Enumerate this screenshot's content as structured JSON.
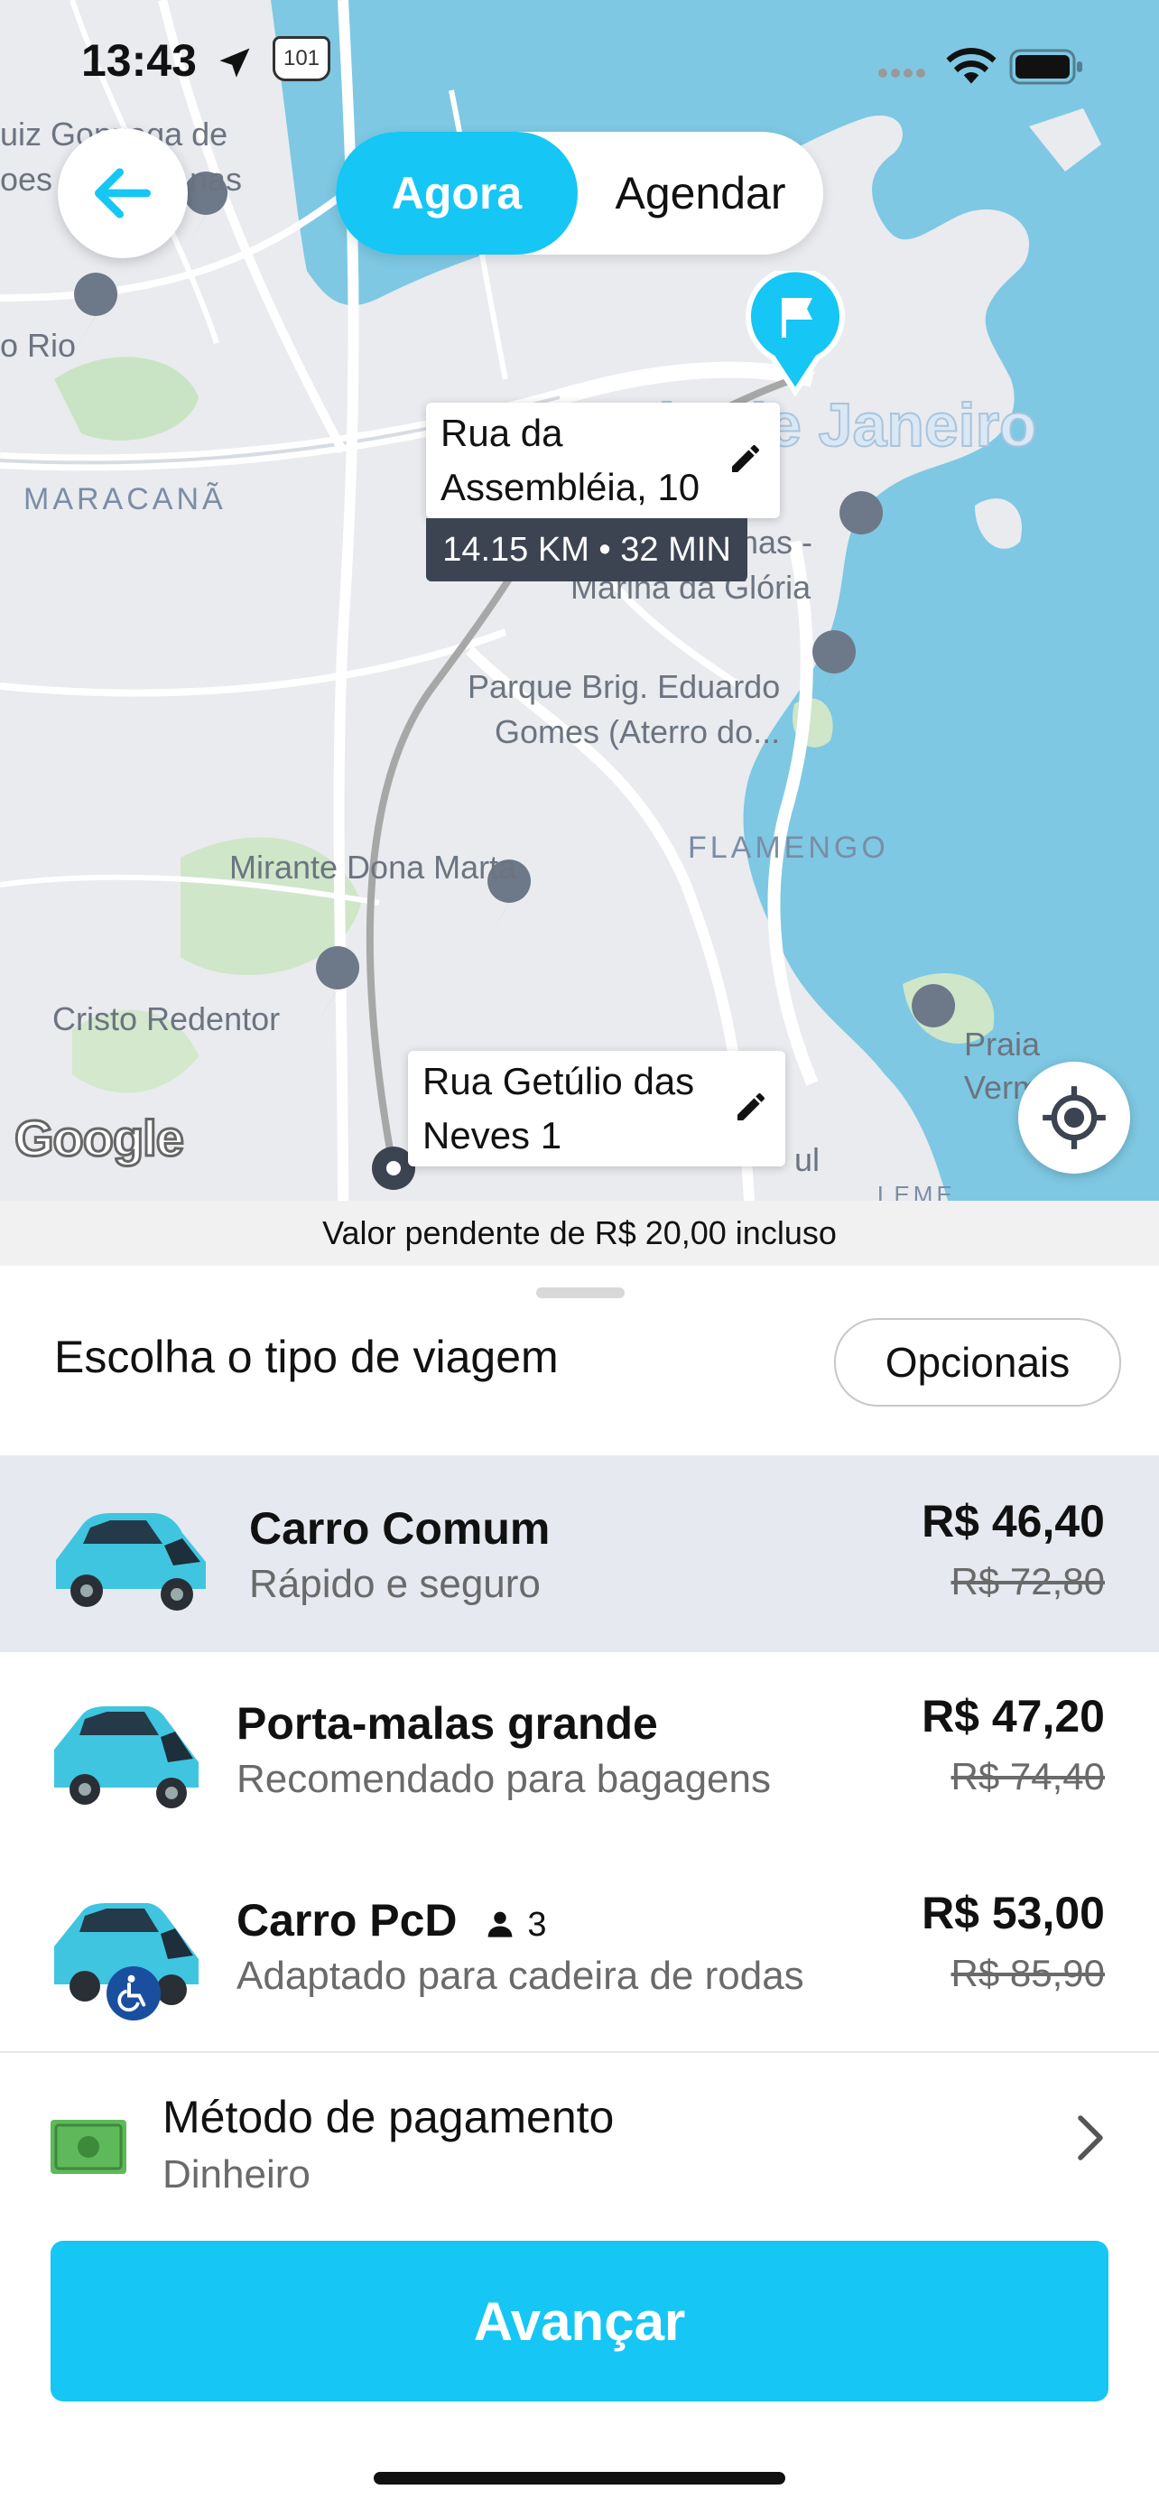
{
  "status": {
    "time": "13:43",
    "route_shield": "101"
  },
  "toggle": {
    "now": "Agora",
    "schedule": "Agendar"
  },
  "map": {
    "labels": {
      "goncalo": "uiz Gonzaga de",
      "goncalo2": "oes M",
      "goncalo3": "nas",
      "rio": "o Rio",
      "maracana": "MARACANÃ",
      "city": "Rio de Janeiro",
      "marina": "Marina da Glória",
      "marina2": "nas -",
      "parque1": "Parque Brig. Eduardo",
      "parque2": "Gomes (Aterro do...",
      "flamengo": "FLAMENGO",
      "mirante": "Mirante Dona Marta",
      "cristo": "Cristo Redentor",
      "praia1": "Praia",
      "praia2": "Verm",
      "leme": "LEME",
      "sul": "ul"
    },
    "destination": {
      "line1": "Rua da",
      "line2": "Assembléia, 10",
      "eta": "14.15 KM • 32 MIN"
    },
    "origin": {
      "line1": "Rua Getúlio das",
      "line2": "Neves 1"
    },
    "attribution": "Google"
  },
  "pending_notice": "Valor pendente de R$ 20,00 incluso",
  "sheet": {
    "title": "Escolha o tipo de viagem",
    "options_label": "Opcionais",
    "rides": [
      {
        "name": "Carro Comum",
        "desc": "Rápido e seguro",
        "price": "R$ 46,40",
        "old_price": "R$ 72,80",
        "selected": true
      },
      {
        "name": "Porta-malas grande",
        "desc": "Recomendado para bagagens",
        "price": "R$ 47,20",
        "old_price": "R$ 74,40",
        "selected": false
      },
      {
        "name": "Carro PcD",
        "seats": "3",
        "desc": "Adaptado para cadeira de rodas",
        "price": "R$ 53,00",
        "old_price": "R$ 85,90",
        "selected": false
      }
    ],
    "payment": {
      "label": "Método de pagamento",
      "value": "Dinheiro"
    },
    "next_label": "Avançar"
  },
  "colors": {
    "accent": "#16c6f5",
    "water": "#7ec8e3",
    "map_bg": "#e9ebef"
  },
  "icons": [
    "back-arrow-icon",
    "location-arrow-icon",
    "signal-icon",
    "wifi-icon",
    "battery-icon",
    "flag-pin-icon",
    "pencil-icon",
    "recenter-icon",
    "car-icon",
    "wheelchair-icon",
    "person-icon",
    "cash-icon",
    "chevron-right-icon"
  ]
}
